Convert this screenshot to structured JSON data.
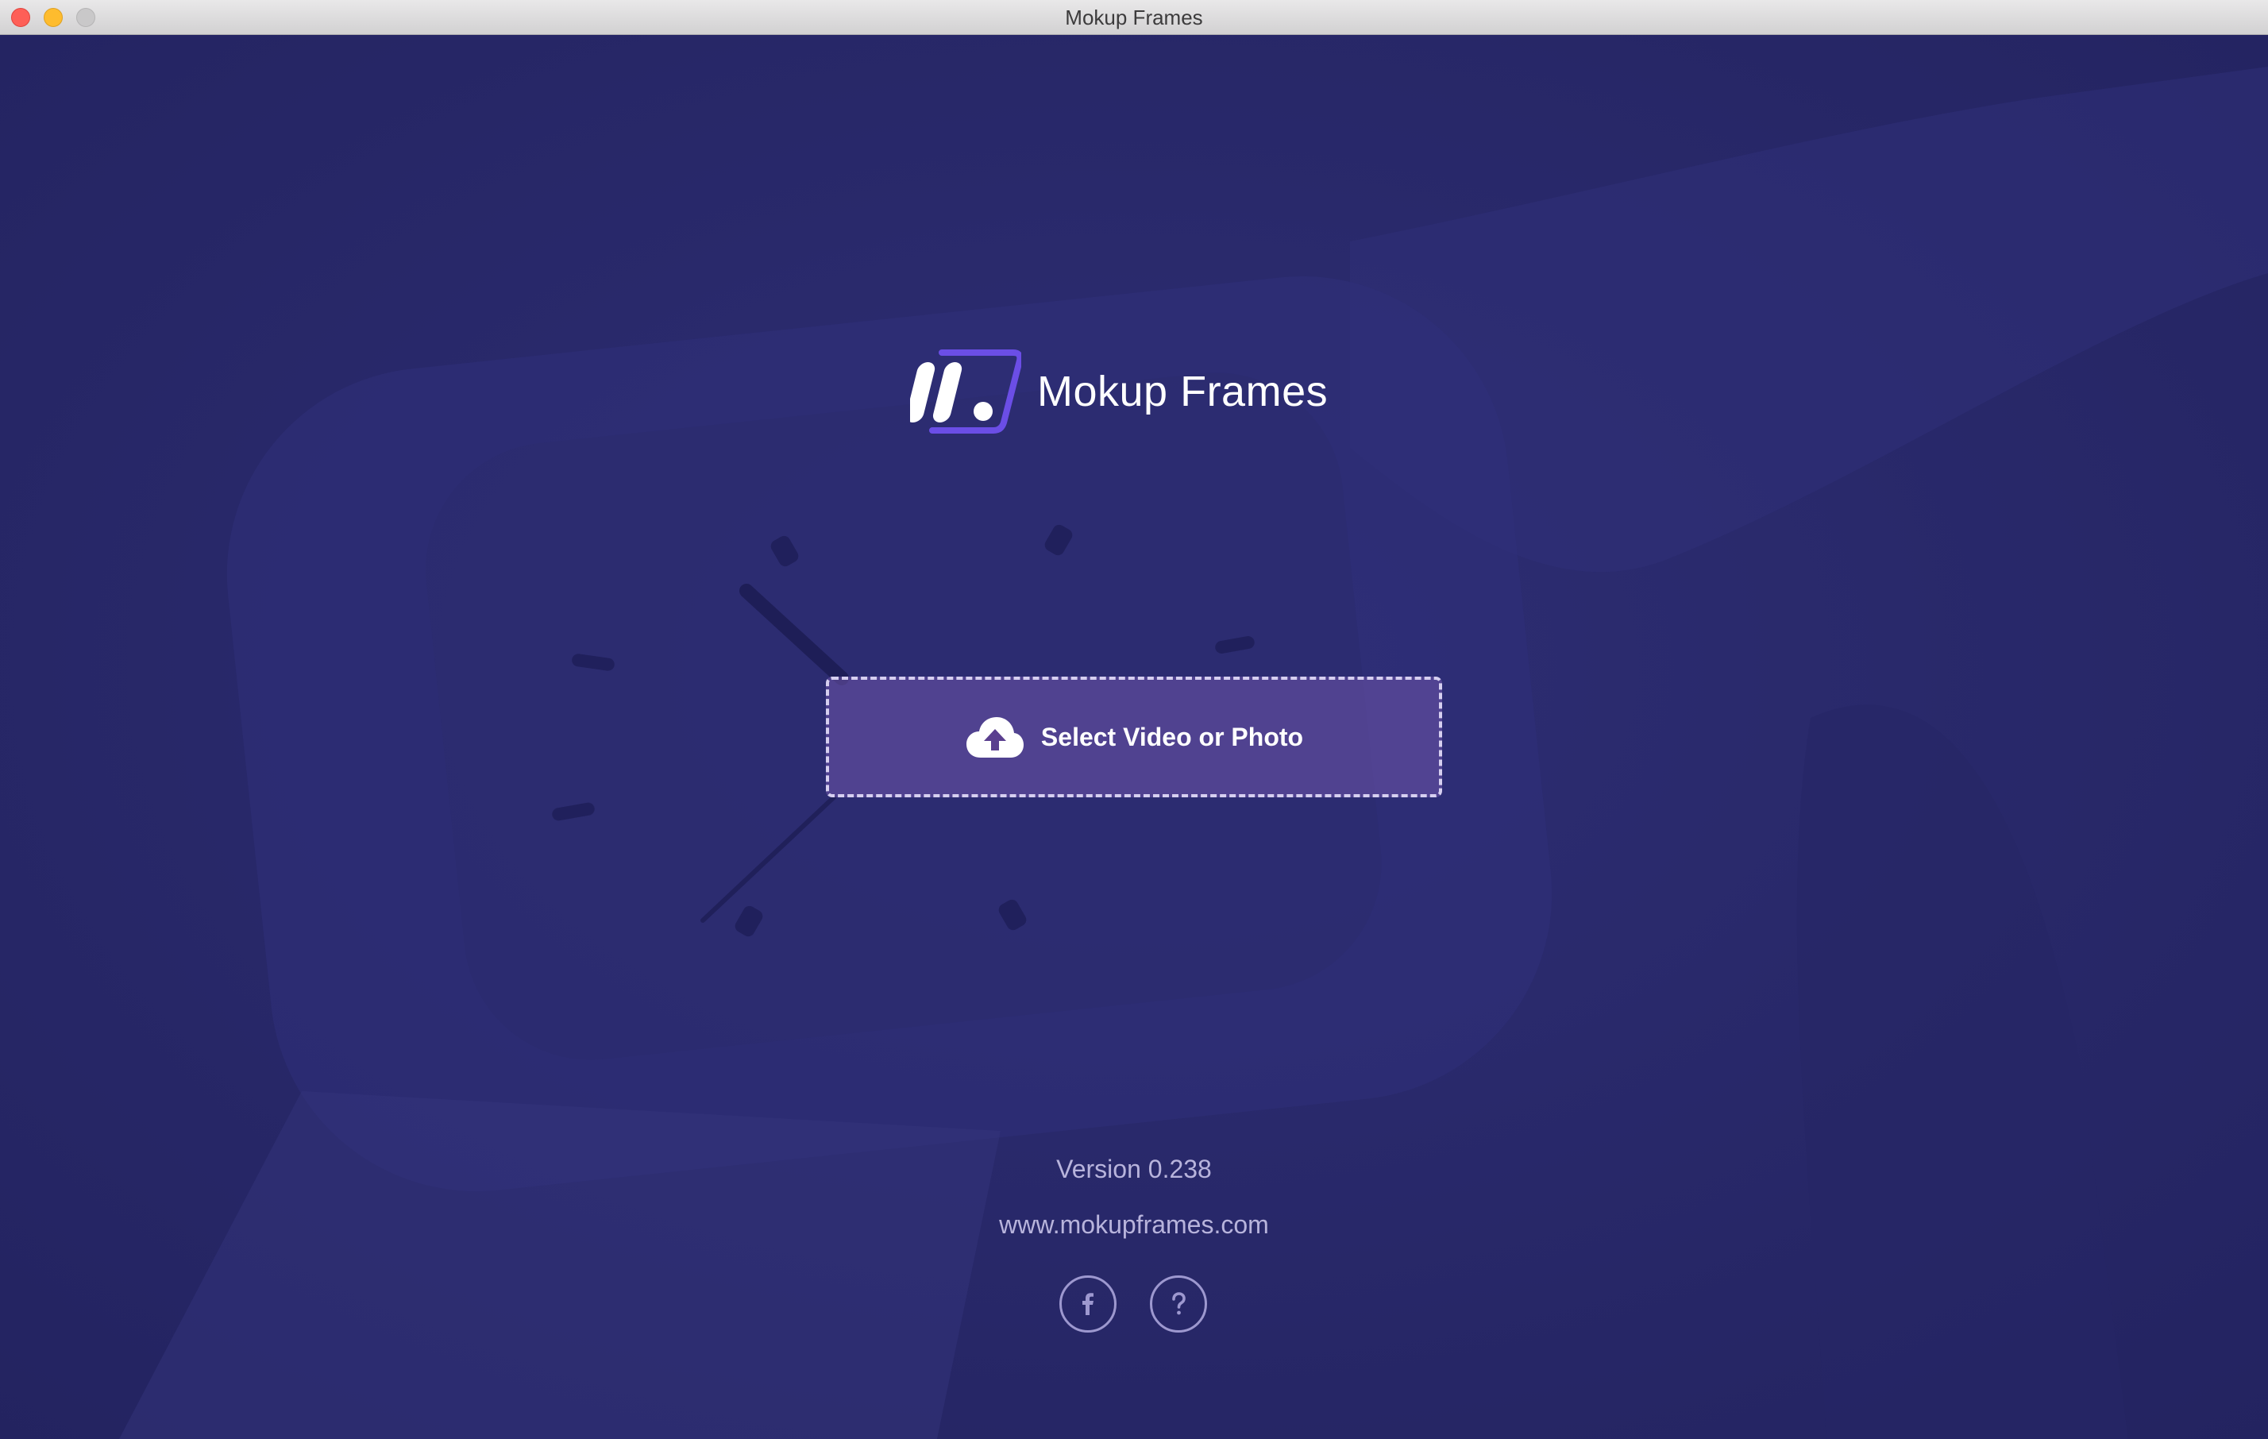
{
  "window": {
    "title": "Mokup Frames"
  },
  "brand": {
    "name": "Mokup Frames",
    "logo_icon": "mokup-frames-logo"
  },
  "main": {
    "select_label": "Select Video or Photo",
    "select_icon": "cloud-upload-icon",
    "version": "Version 0.238",
    "website": "www.mokupframes.com"
  },
  "social": {
    "facebook_icon": "facebook-icon",
    "help_icon": "help-icon"
  },
  "colors": {
    "background": "#2a2a6c",
    "button_fill": "#5a3f8f",
    "accent": "#7b5cf0",
    "muted_text": "#b8b4dc"
  }
}
